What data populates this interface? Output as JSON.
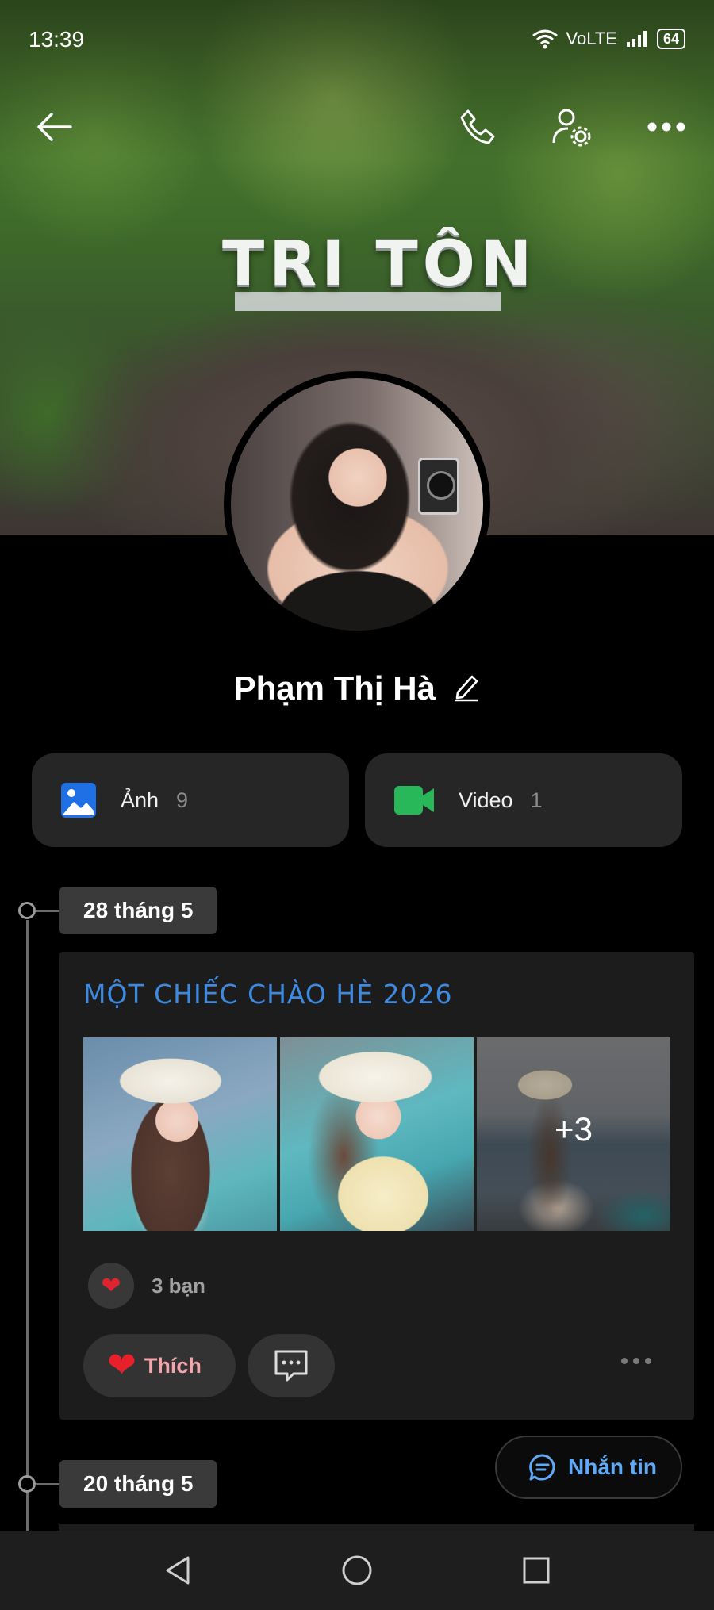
{
  "status_bar": {
    "time": "13:39",
    "network": "VoLTE",
    "battery": "64"
  },
  "cover": {
    "sign_text": "TRI TÔN"
  },
  "profile": {
    "name": "Phạm Thị Hà"
  },
  "media": {
    "photos": {
      "label": "Ảnh",
      "count": "9"
    },
    "videos": {
      "label": "Video",
      "count": "1"
    }
  },
  "timeline": [
    {
      "date": "28 tháng 5",
      "post": {
        "title": "MỘT CHIẾC CHÀO HÈ 2026",
        "extra_photos": "+3",
        "reactions": "3 bạn",
        "like_label": "Thích"
      }
    },
    {
      "date": "20 tháng 5"
    }
  ],
  "message_button": {
    "label": "Nhắn tin"
  },
  "icons": {
    "back": "arrow-left-icon",
    "call": "phone-icon",
    "settings": "user-settings-icon",
    "more": "more-horizontal-icon",
    "edit": "pencil-icon",
    "photos": "image-icon",
    "videos": "video-camera-icon",
    "comment": "comment-icon",
    "message": "chat-bubble-icon"
  },
  "colors": {
    "accent_blue": "#3d8ae0",
    "heart": "#e8202c",
    "photo_icon": "#1f6fe5",
    "video_icon": "#28b85a"
  }
}
